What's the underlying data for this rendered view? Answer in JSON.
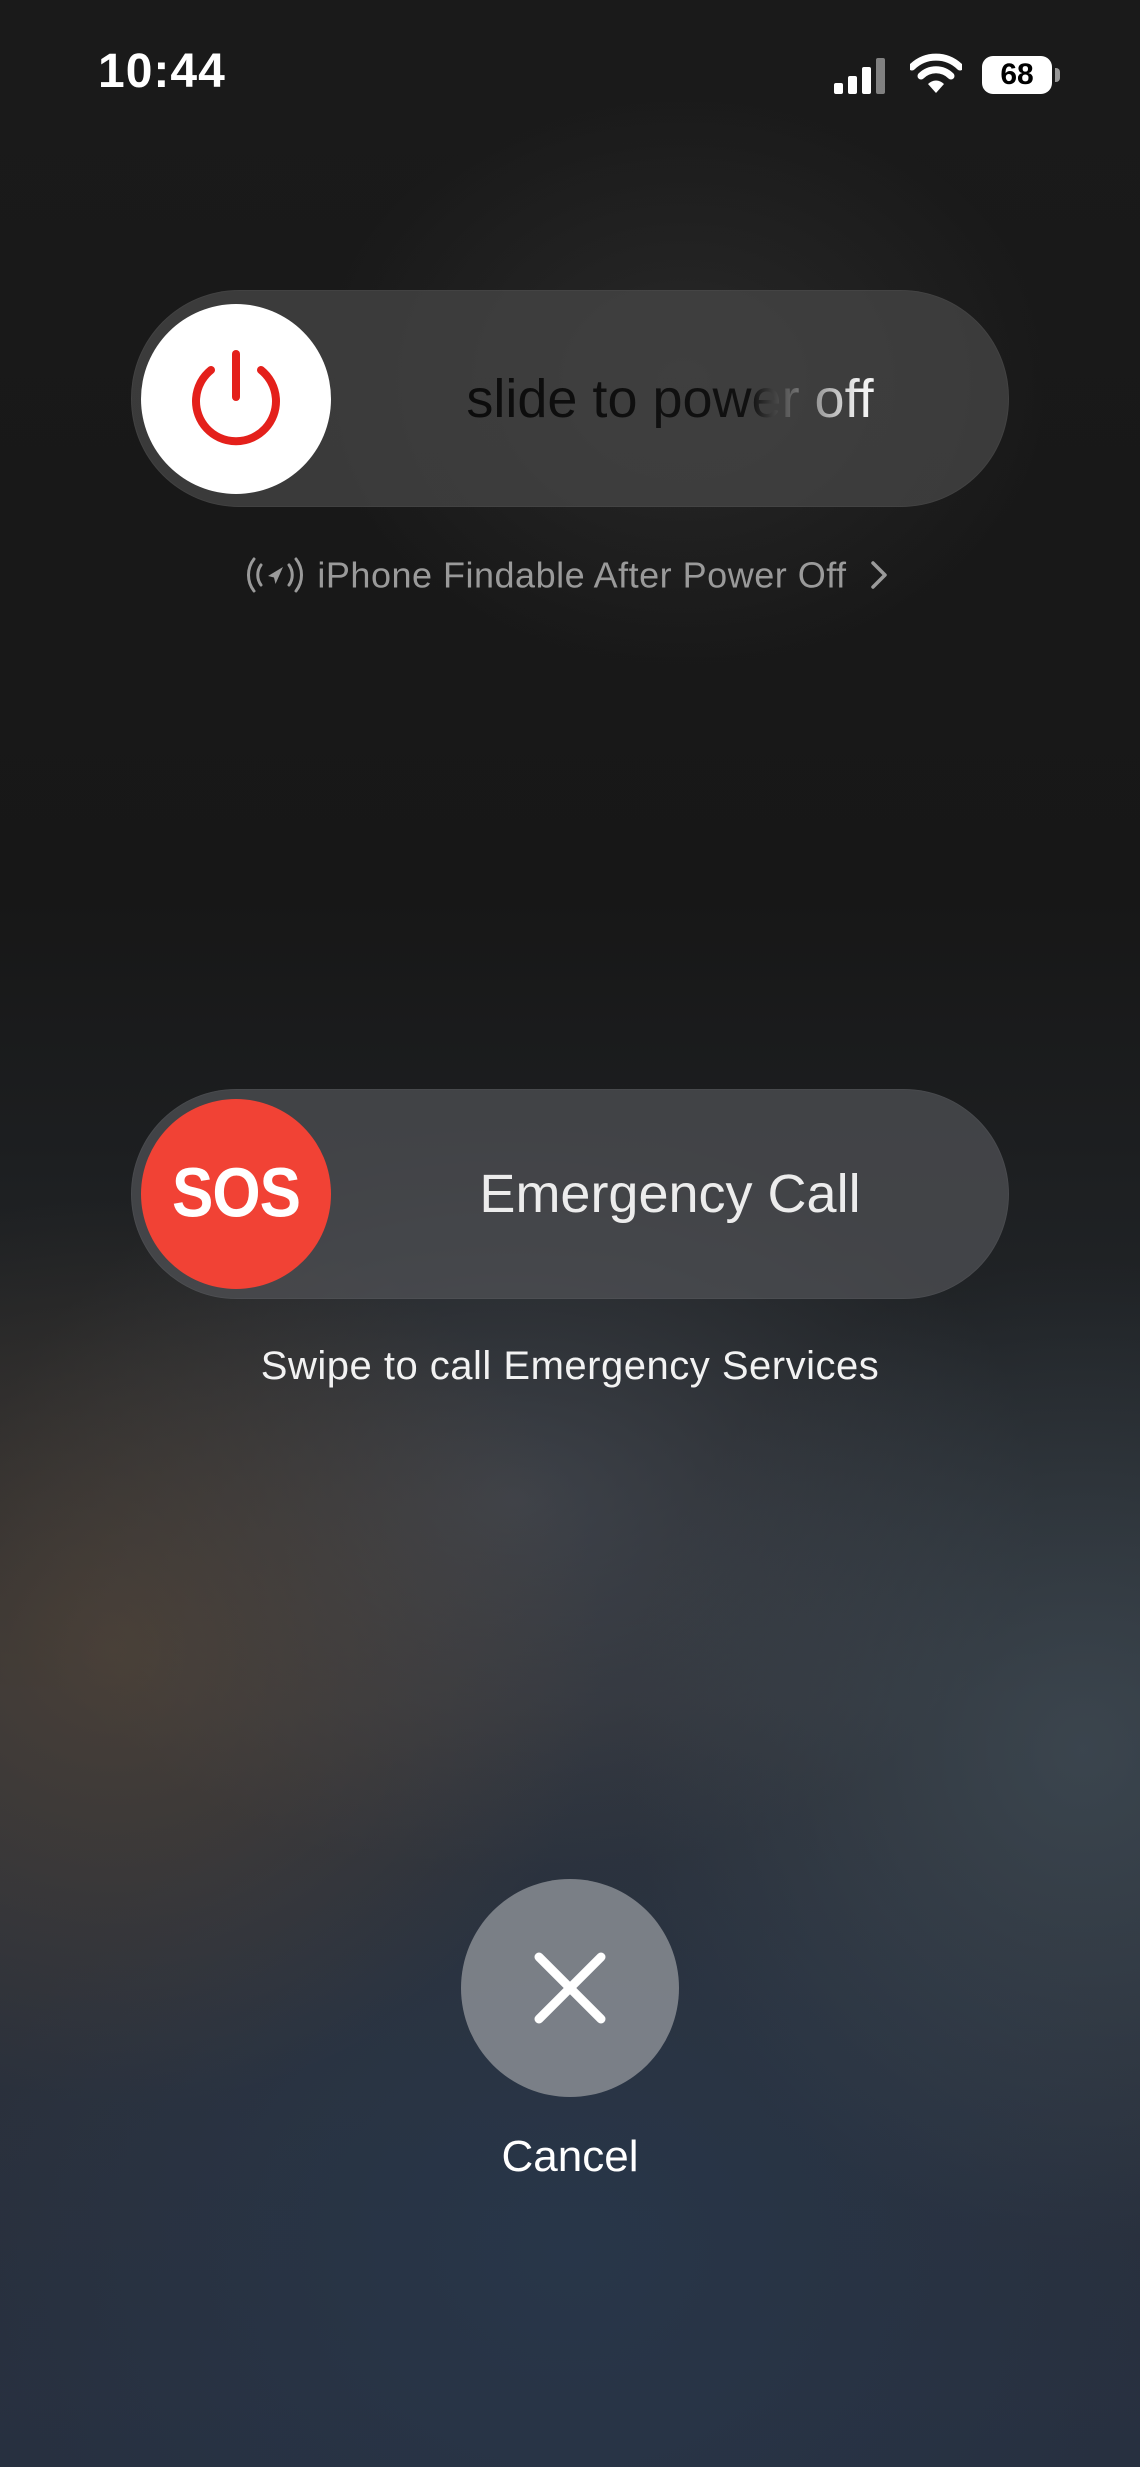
{
  "status_bar": {
    "time": "10:44",
    "battery_level": "68",
    "icons": [
      "signal-icon",
      "wifi-icon",
      "battery-icon"
    ]
  },
  "power_slider": {
    "label": "slide to power off",
    "knob_icon": "power-icon",
    "icon_color": "#e4201b"
  },
  "findable": {
    "text": "iPhone Findable After Power Off",
    "icons": [
      "find-my-icon",
      "chevron-right-icon"
    ]
  },
  "sos_slider": {
    "knob_text": "SOS",
    "label": "Emergency Call",
    "knob_color": "#f14235"
  },
  "sos_hint": "Swipe to call Emergency Services",
  "cancel": {
    "label": "Cancel",
    "icon": "close-icon"
  }
}
